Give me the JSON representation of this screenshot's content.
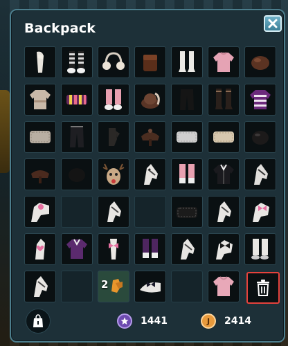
{
  "window": {
    "title": "Backpack"
  },
  "inventory": {
    "rows": [
      [
        "horse-leg-wrap-icon",
        "striped-socks-shoes-icon",
        "earmuffs-icon",
        "leather-saddlebag-icon",
        "white-riding-boots-icon",
        "pink-sweater-icon",
        "brown-riding-helmet-icon"
      ],
      [
        "cream-sweater-icon",
        "striped-scarf-icon",
        "pink-leg-wraps-icon",
        "feathered-hat-icon",
        "black-pants-icon",
        "tall-brown-boots-icon",
        "purple-striped-sweater-icon"
      ],
      [
        "saddle-pad-icon",
        "black-jeans-icon",
        "dark-gloves-icon",
        "western-saddle-icon",
        "grey-saddle-pad-icon",
        "beige-saddle-pad-icon",
        "black-helmet-icon"
      ],
      [
        "brown-saddle-icon",
        "black-helmet-icon",
        "reindeer-headgear-icon",
        "white-horse-bridle-icon",
        "pink-hoof-boots-icon",
        "black-jacket-icon",
        "white-horse-bridle-icon"
      ],
      [
        "horse-pink-flower-icon",
        "empty",
        "white-horse-bridle-icon",
        "empty",
        "black-saddle-pad-icon",
        "white-horse-bridle-icon",
        "horse-pink-bow-icon"
      ],
      [
        "horse-pink-heart-icon",
        "purple-jacket-icon",
        "horse-leg-pink-bow-icon",
        "purple-horse-wraps-icon",
        "white-horse-bridle-icon",
        "horse-black-bow-icon",
        "white-horse-wraps-icon"
      ],
      [
        "white-horse-bridle-icon",
        "empty",
        "orange-gloves-icon",
        "horse-tail-bow-icon",
        "empty",
        "pink-hoodie-icon",
        "trash"
      ]
    ],
    "stacked_item": {
      "row": 6,
      "col": 2,
      "count": "2"
    }
  },
  "footer": {
    "shop_icon": "shopping-bag-icon",
    "star_coins": "1441",
    "jorvik_coins": "2414",
    "jorvik_symbol": "J",
    "colors": {
      "star_coin": "#6d4bb0",
      "jorvik_coin": "#e89a3c",
      "trash_border": "#e6423c",
      "panel_border": "#4c7e8d"
    }
  }
}
